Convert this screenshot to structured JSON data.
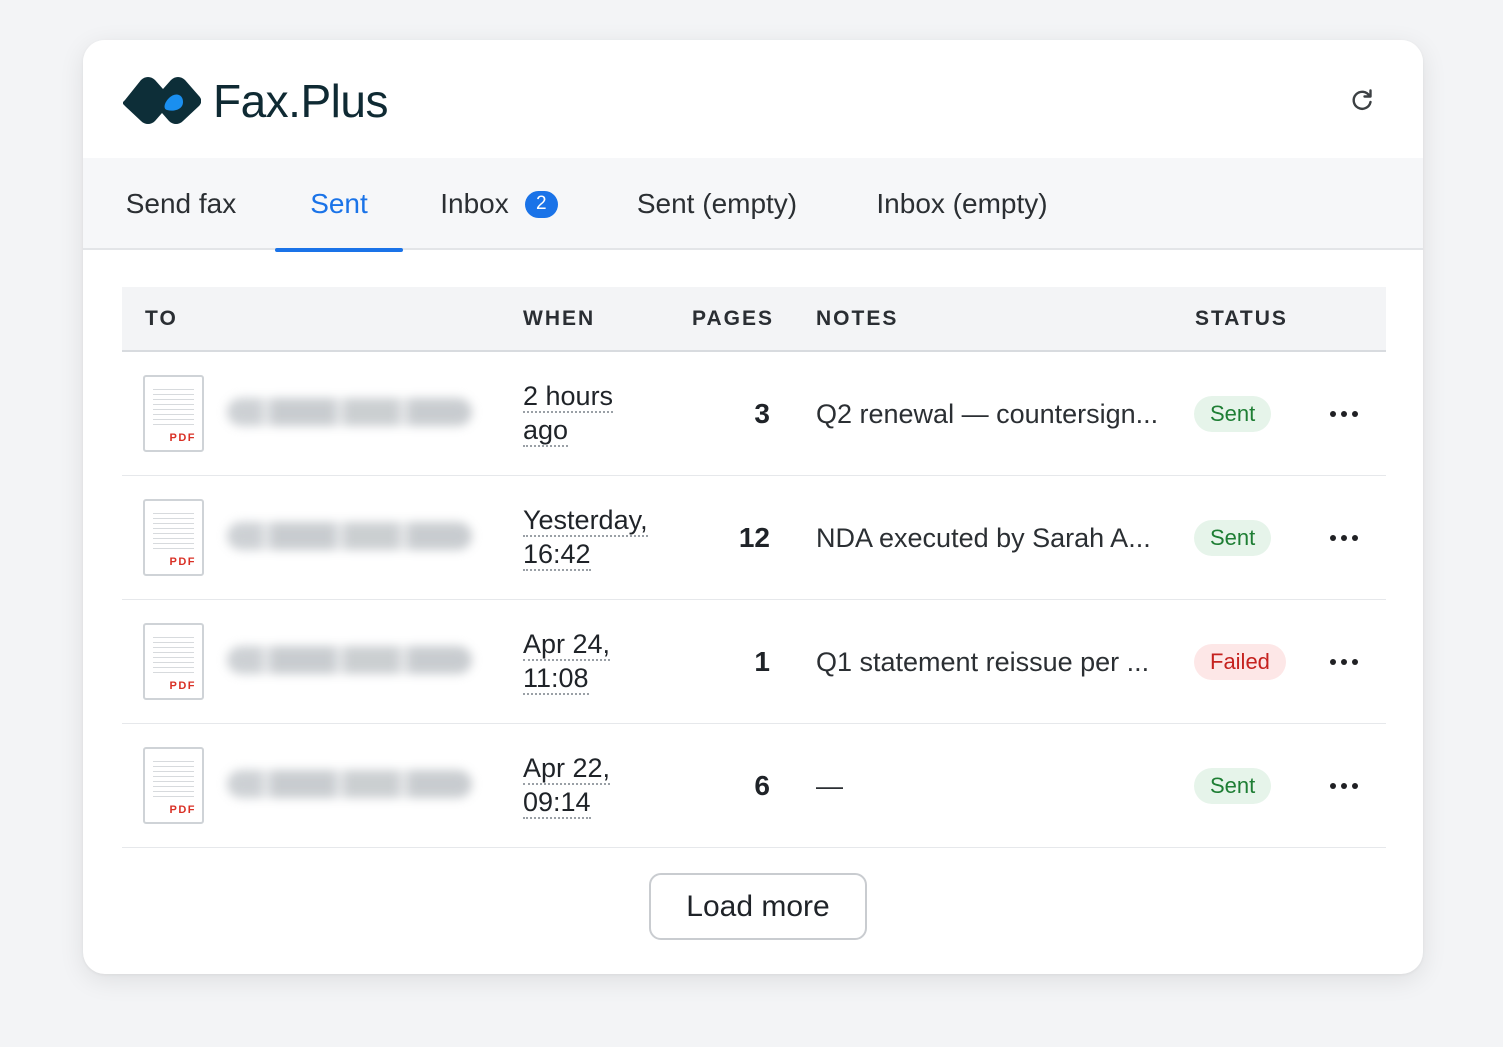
{
  "brand": {
    "name": "Fax.Plus"
  },
  "tabs": [
    {
      "label": "Send fax"
    },
    {
      "label": "Sent"
    },
    {
      "label": "Inbox",
      "badge": "2"
    },
    {
      "label": "Sent (empty)"
    },
    {
      "label": "Inbox (empty)"
    }
  ],
  "table": {
    "headers": {
      "to": "TO",
      "when": "WHEN",
      "pages": "PAGES",
      "notes": "NOTES",
      "status": "STATUS"
    },
    "rows": [
      {
        "file_tag": "PDF",
        "when_1": "2 hours",
        "when_2": "ago",
        "pages": "3",
        "notes": "Q2 renewal — countersign...",
        "status": "Sent"
      },
      {
        "file_tag": "PDF",
        "when_1": "Yesterday,",
        "when_2": "16:42",
        "pages": "12",
        "notes": "NDA executed by Sarah A...",
        "status": "Sent"
      },
      {
        "file_tag": "PDF",
        "when_1": "Apr 24,",
        "when_2": "11:08",
        "pages": "1",
        "notes": "Q1 statement reissue per ...",
        "status": "Failed"
      },
      {
        "file_tag": "PDF",
        "when_1": "Apr 22,",
        "when_2": "09:14",
        "pages": "6",
        "notes": "—",
        "status": "Sent"
      }
    ]
  },
  "load_more": "Load more",
  "colors": {
    "accent": "#1a73e8",
    "sent_bg": "#e6f4ea",
    "sent_text": "#1e7e34",
    "failed_bg": "#fde7e7",
    "failed_text": "#c5221f"
  },
  "icons": {
    "logo": "fax-plus-logo-icon",
    "refresh": "refresh-icon",
    "file": "pdf-file-icon",
    "more": "more-horizontal-icon"
  }
}
